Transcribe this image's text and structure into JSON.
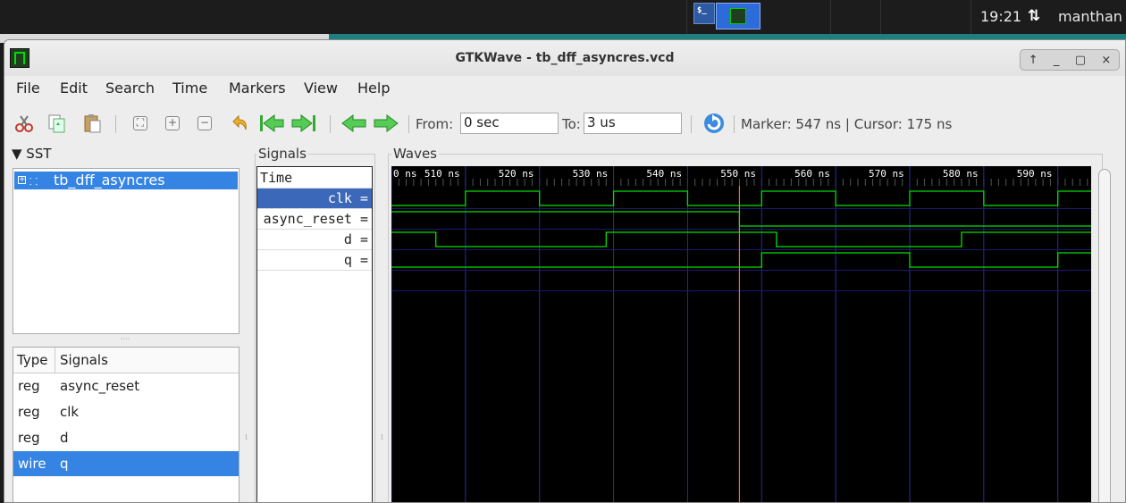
{
  "desktop": {
    "terminal_icon_glyph": "$_",
    "clock": "19:21",
    "network_icon": "⇅",
    "user": "manthan"
  },
  "window": {
    "title": "GTKWave - tb_dff_asyncres.vcd",
    "controls": [
      "↑",
      "_",
      "▢",
      "×"
    ]
  },
  "menu": [
    "File",
    "Edit",
    "Search",
    "Time",
    "Markers",
    "View",
    "Help"
  ],
  "toolbar": {
    "from_label": "From:",
    "from_value": "0 sec",
    "to_label": "To:",
    "to_value": "3 us",
    "marker_status": "Marker: 547 ns  |  Cursor: 175 ns",
    "icons": [
      "cut-icon",
      "copy-icon",
      "paste-icon",
      "zoom-fit-icon",
      "zoom-in-icon",
      "zoom-out-icon",
      "undo-zoom-icon",
      "zoom-start-icon",
      "zoom-end-icon",
      "prev-edge-icon",
      "next-edge-icon",
      "reload-icon"
    ]
  },
  "sst": {
    "header": "▼ SST",
    "tree_item": "tb_dff_asyncres",
    "type_header": {
      "type": "Type",
      "signals": "Signals"
    },
    "rows": [
      {
        "type": "reg",
        "name": "async_reset",
        "selected": false
      },
      {
        "type": "reg",
        "name": "clk",
        "selected": false
      },
      {
        "type": "reg",
        "name": "d",
        "selected": false
      },
      {
        "type": "wire",
        "name": "q",
        "selected": true
      }
    ]
  },
  "signals": {
    "header": "Signals",
    "time_label": "Time",
    "rows": [
      {
        "label": "clk =",
        "selected": true
      },
      {
        "label": "async_reset =",
        "selected": false
      },
      {
        "label": "d =",
        "selected": false
      },
      {
        "label": "q =",
        "selected": false
      }
    ]
  },
  "waves": {
    "header": "Waves",
    "tick_labels": [
      "0 ns",
      "510 ns",
      "520 ns",
      "530 ns",
      "540 ns",
      "550 ns",
      "560 ns",
      "570 ns",
      "580 ns",
      "590 ns"
    ],
    "time_start_ns": 500,
    "time_end_ns": 594.5,
    "marker_ns": 547,
    "colors": {
      "trace": "#00e000",
      "grid": "#2a2aa0",
      "marker": "#ff5a5a",
      "background": "#000000"
    },
    "traces": {
      "clk": {
        "initial": 0,
        "edges_ns": [
          510,
          520,
          530,
          540,
          550,
          560,
          570,
          580,
          590
        ]
      },
      "async_reset": {
        "initial": 1,
        "edges_ns": [
          547
        ]
      },
      "d": {
        "initial": 1,
        "edges_ns": [
          506,
          529,
          552,
          577
        ]
      },
      "q": {
        "initial": 0,
        "edges_ns": [
          550,
          570,
          590
        ]
      }
    }
  }
}
